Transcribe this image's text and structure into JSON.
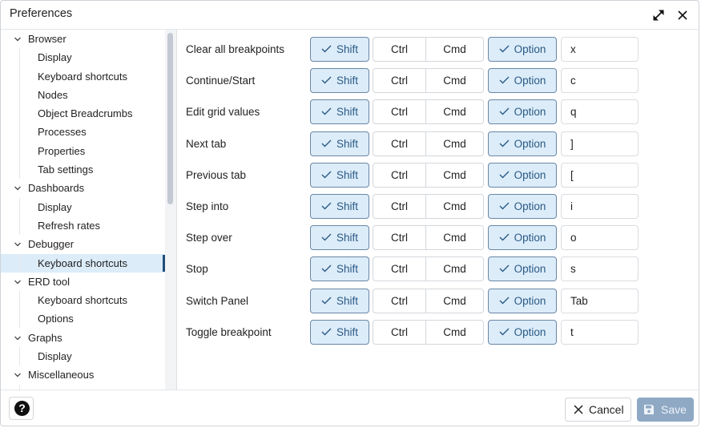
{
  "window": {
    "title": "Preferences",
    "expand_icon": "expand-arrows-icon",
    "close_icon": "close-icon"
  },
  "sidebar": {
    "groups": [
      {
        "label": "Browser",
        "expanded": true,
        "children": [
          "Display",
          "Keyboard shortcuts",
          "Nodes",
          "Object Breadcrumbs",
          "Processes",
          "Properties",
          "Tab settings"
        ]
      },
      {
        "label": "Dashboards",
        "expanded": true,
        "children": [
          "Display",
          "Refresh rates"
        ]
      },
      {
        "label": "Debugger",
        "expanded": true,
        "children": [
          "Keyboard shortcuts"
        ]
      },
      {
        "label": "ERD tool",
        "expanded": true,
        "children": [
          "Keyboard shortcuts",
          "Options"
        ]
      },
      {
        "label": "Graphs",
        "expanded": true,
        "children": [
          "Display"
        ]
      },
      {
        "label": "Miscellaneous",
        "expanded": true,
        "children": []
      }
    ],
    "selected": "Debugger > Keyboard shortcuts"
  },
  "shortcuts": {
    "modifier_labels": {
      "shift": "Shift",
      "ctrl": "Ctrl",
      "cmd": "Cmd",
      "option": "Option"
    },
    "rows": [
      {
        "label": "Clear all breakpoints",
        "shift": true,
        "ctrl": false,
        "cmd": false,
        "option": true,
        "key": "x"
      },
      {
        "label": "Continue/Start",
        "shift": true,
        "ctrl": false,
        "cmd": false,
        "option": true,
        "key": "c"
      },
      {
        "label": "Edit grid values",
        "shift": true,
        "ctrl": false,
        "cmd": false,
        "option": true,
        "key": "q"
      },
      {
        "label": "Next tab",
        "shift": true,
        "ctrl": false,
        "cmd": false,
        "option": true,
        "key": "]"
      },
      {
        "label": "Previous tab",
        "shift": true,
        "ctrl": false,
        "cmd": false,
        "option": true,
        "key": "["
      },
      {
        "label": "Step into",
        "shift": true,
        "ctrl": false,
        "cmd": false,
        "option": true,
        "key": "i"
      },
      {
        "label": "Step over",
        "shift": true,
        "ctrl": false,
        "cmd": false,
        "option": true,
        "key": "o"
      },
      {
        "label": "Stop",
        "shift": true,
        "ctrl": false,
        "cmd": false,
        "option": true,
        "key": "s"
      },
      {
        "label": "Switch Panel",
        "shift": true,
        "ctrl": false,
        "cmd": false,
        "option": true,
        "key": "Tab"
      },
      {
        "label": "Toggle breakpoint",
        "shift": true,
        "ctrl": false,
        "cmd": false,
        "option": true,
        "key": "t"
      }
    ]
  },
  "footer": {
    "help_icon": "question-circle-icon",
    "cancel_label": "Cancel",
    "save_label": "Save",
    "save_enabled": false
  },
  "colors": {
    "accent_active_bg": "#dcecf9",
    "accent_active_border": "#6a87a6",
    "accent_text": "#2a5a85",
    "selected_marker": "#1f4e7a",
    "save_disabled_bg": "#8fa9c4"
  }
}
